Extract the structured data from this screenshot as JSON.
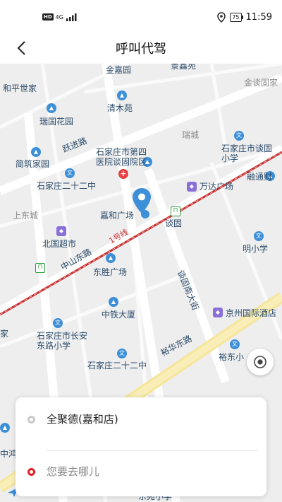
{
  "status_bar": {
    "network_badge": "HD",
    "network_type": "4G",
    "battery": "75",
    "time": "11:59"
  },
  "header": {
    "title": "呼叫代驾"
  },
  "map": {
    "labels": {
      "jinjiayuan": "金嘉园",
      "jingxinyuan": "景鑫苑",
      "jintanyuan": "金谈固家",
      "hepingshijia": "和平世家",
      "qingmuyuan": "清木苑",
      "ruiguohuayuan": "瑞国花园",
      "ruicheng": "瑞城",
      "yuejinlu": "跃进路",
      "hospital": "石家庄市第四医院谈固院区",
      "school_tangu": "石家庄市谈固小学",
      "jianzhujiayuan": "简筑家园",
      "rongtongcai": "融通财",
      "school_22_north": "石家庄二十二中",
      "wandaguangchang": "万达广场",
      "shangdongcheng": "上东城",
      "jiaheguangchang": "嘉和广场",
      "tangu": "谈固",
      "beiguochaoshi": "北国超市",
      "jianmingxiaoxue": "明小学",
      "line1": "1号线",
      "zhongshandonglu": "中山东路",
      "dongshengguangchang": "东胜广场",
      "tangunandajie": "谈固南大街",
      "zhongtiedasha": "中铁大厦",
      "jingzhou_hotel": "京州国际酒店",
      "school_changan": "石家庄市长安东路小学",
      "yuhuadonglu": "裕华东路",
      "yudongxiao": "裕东小",
      "school_22_south": "石家庄二十二中",
      "dongyuanxiaoxue": "东苑小学",
      "partial_zhonghong": "中鸿",
      "left_edge": "家"
    }
  },
  "route_card": {
    "start_location": "全聚德(嘉和店)",
    "destination_placeholder": "您要去哪儿"
  },
  "icons": {
    "back": "chevron-left-icon",
    "pin": "location-pin-icon",
    "locate": "locate-icon",
    "location_status": "location-status-icon",
    "signal": "signal-icon"
  },
  "colors": {
    "accent_blue": "#3d8fd8",
    "destination_red": "#e02020",
    "metro_line": "#c83030"
  }
}
